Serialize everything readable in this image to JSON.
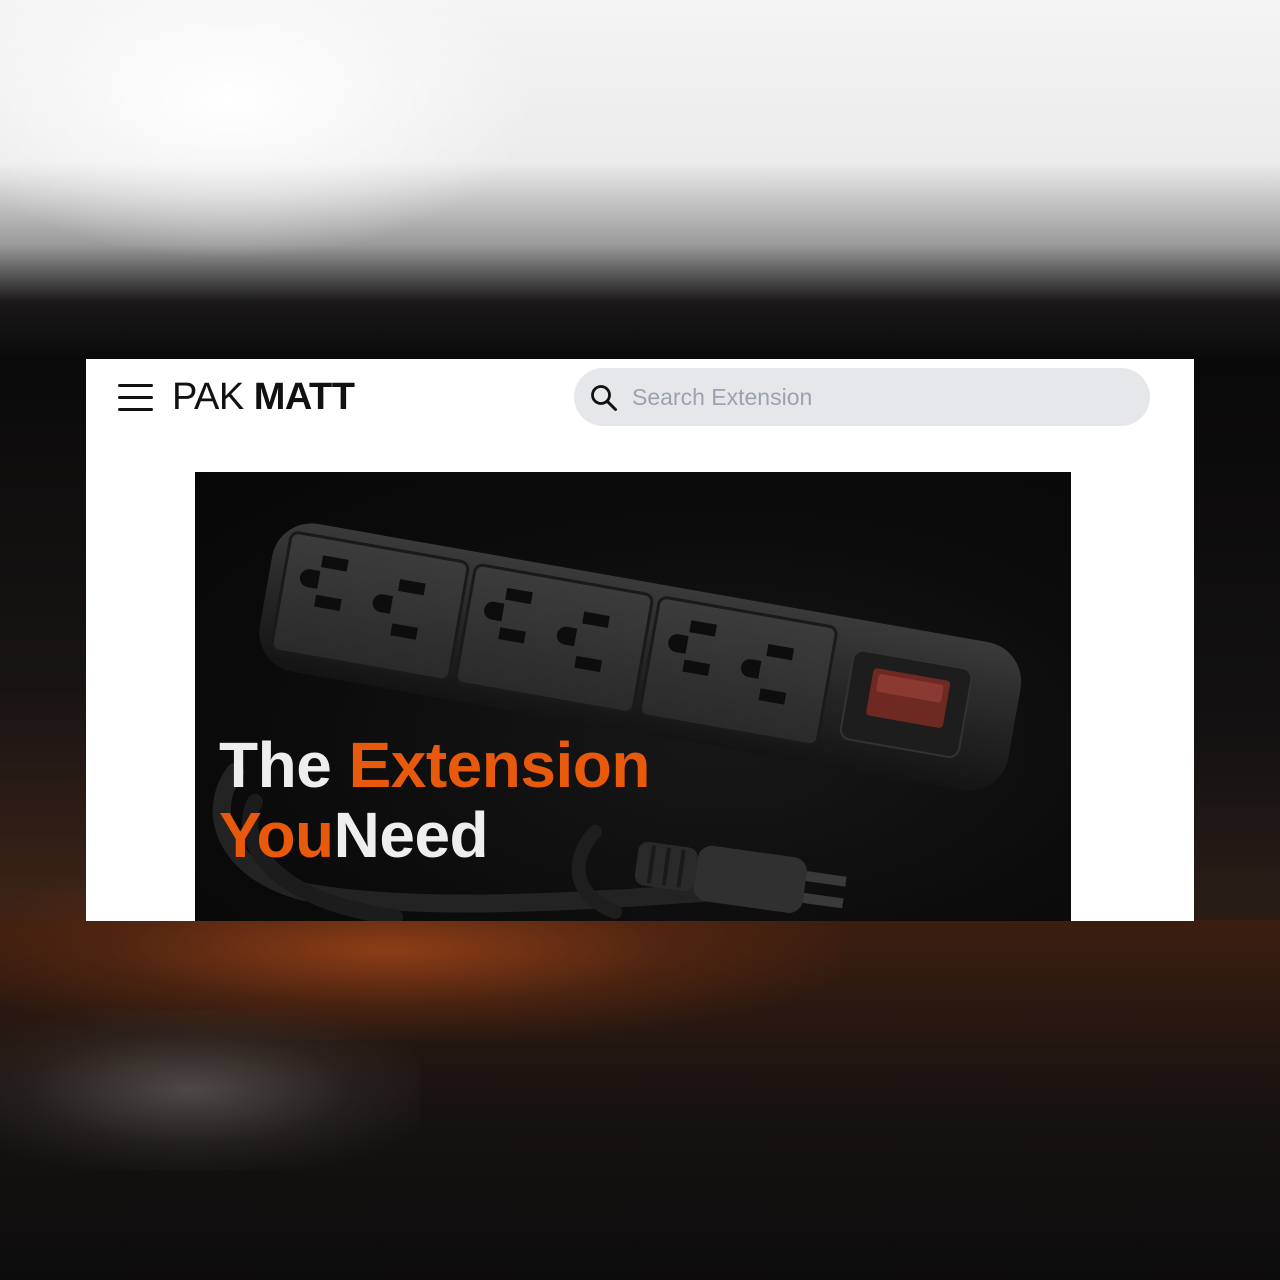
{
  "header": {
    "brand_light": "PAK",
    "brand_bold": "MATT",
    "menu_icon": "hamburger-menu-icon"
  },
  "search": {
    "placeholder": "Search Extension",
    "icon": "search-icon"
  },
  "hero": {
    "line1_white": "The ",
    "line1_orange": "Extension",
    "line2_orange": "You",
    "line2_white": "Need",
    "image": "power-strip-extension-cord"
  },
  "colors": {
    "accent": "#e8590c",
    "text_dark": "#111111",
    "search_bg": "#e5e7eb",
    "hero_bg": "#0c0c0c"
  }
}
